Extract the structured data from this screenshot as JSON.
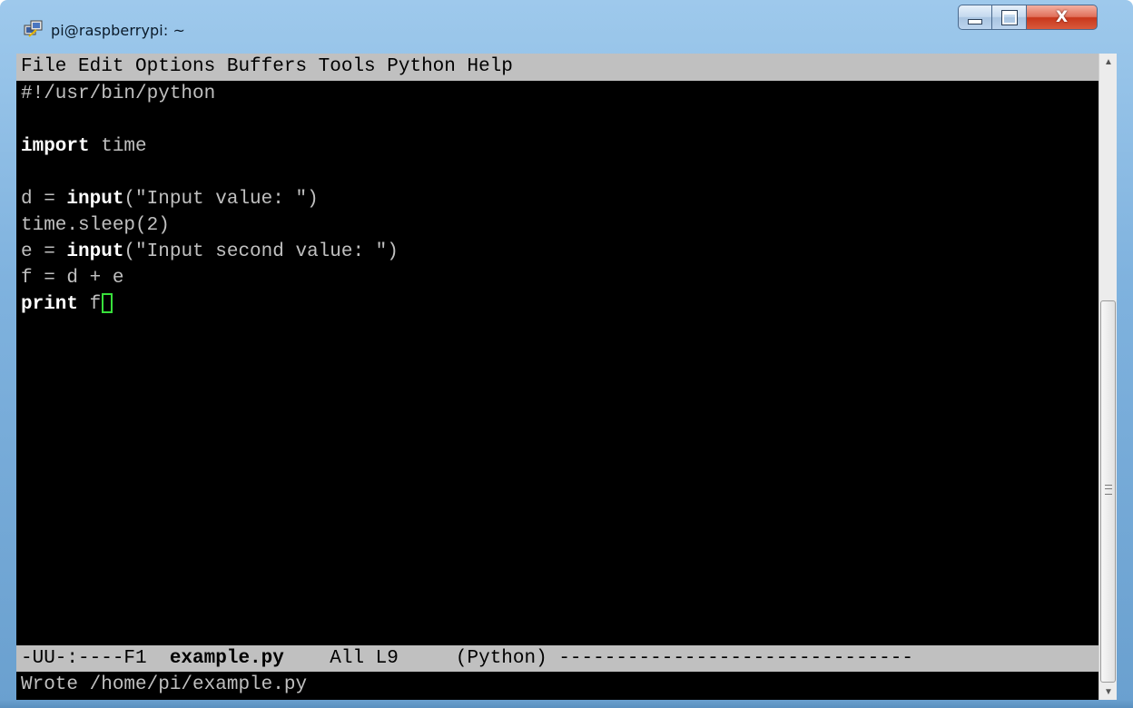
{
  "window": {
    "title": "pi@raspberrypi: ~",
    "icon": "putty-icon",
    "controls": {
      "minimize_icon": "minimize-icon",
      "maximize_icon": "maximize-icon",
      "close_label": "X"
    }
  },
  "emacs": {
    "menubar": "File Edit Options Buffers Tools Python Help",
    "lines": [
      {
        "text": "#!/usr/bin/python"
      },
      {
        "text": ""
      },
      {
        "kw": "import",
        "rest": " time"
      },
      {
        "text": ""
      },
      {
        "pre": "d = ",
        "kw": "input",
        "rest": "(\"Input value: \")"
      },
      {
        "text": "time.sleep(2)"
      },
      {
        "pre": "e = ",
        "kw": "input",
        "rest": "(\"Input second value: \")"
      },
      {
        "text": "f = d + e"
      },
      {
        "kw": "print",
        "rest": " f"
      }
    ],
    "modeline": {
      "prefix": "-UU-:----F1  ",
      "buffer": "example.py",
      "middle": "    All L9     (Python) ",
      "fill": "-------------------------------"
    },
    "echo_area": "Wrote /home/pi/example.py"
  },
  "colors": {
    "terminal_bg": "#000000",
    "text": "#c0c0c0",
    "menubar_bg": "#c0c0c0",
    "cursor": "#38e03b"
  }
}
